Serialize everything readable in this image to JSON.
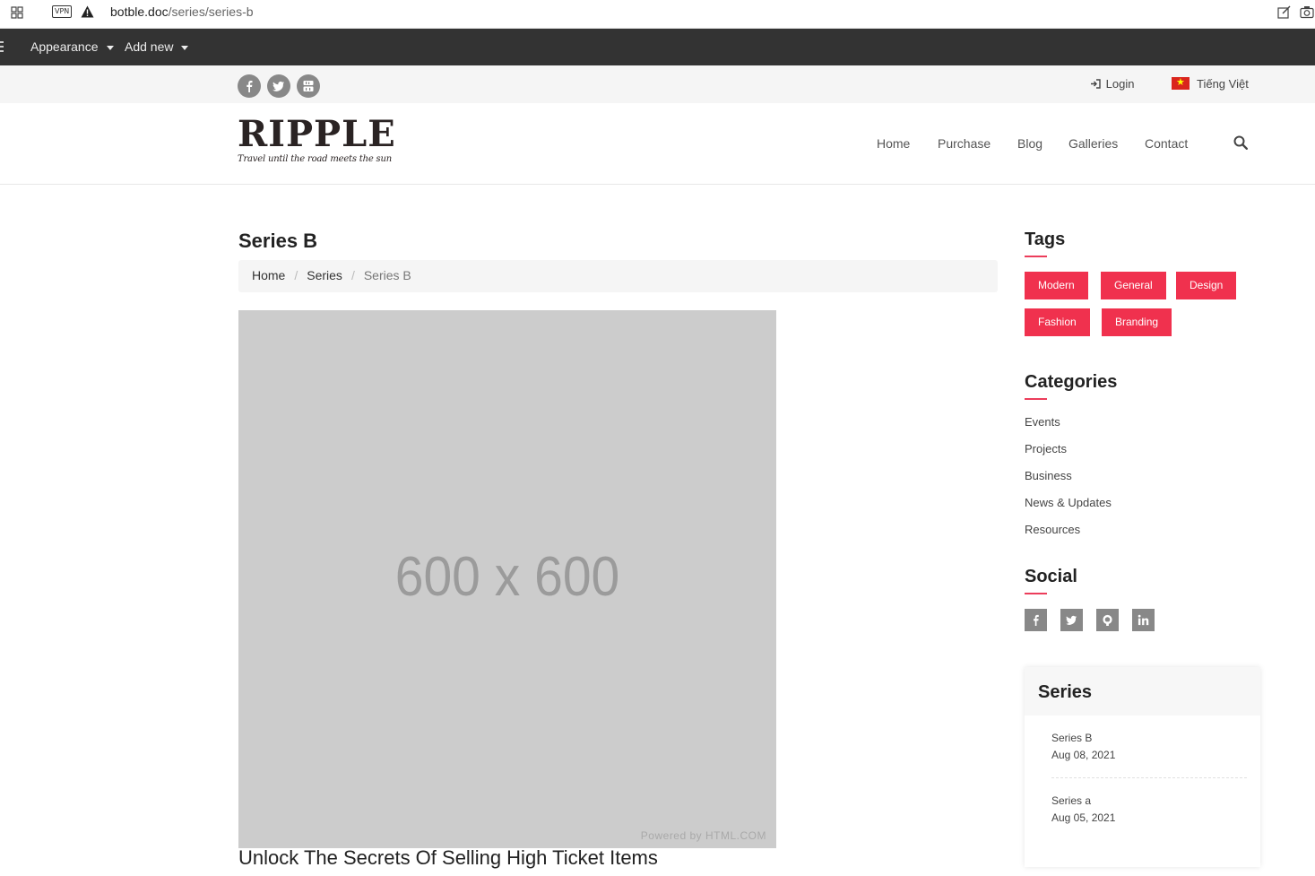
{
  "browser": {
    "url_domain": "botble.doc",
    "url_path": "/series/series-b",
    "vpn_label": "VPN",
    "icons": [
      "grid-icon",
      "warning-icon",
      "edit-icon",
      "camera-icon"
    ]
  },
  "adminbar": {
    "appearance_label": "Appearance",
    "add_new_label": "Add new"
  },
  "topbar": {
    "social_icons": [
      "facebook-icon",
      "twitter-icon",
      "youtube-icon"
    ],
    "login_label": "Login",
    "language_label": "Tiếng Việt"
  },
  "header": {
    "logo_text": "RIPPLE",
    "logo_tagline": "Travel until the road meets the sun",
    "nav": [
      "Home",
      "Purchase",
      "Blog",
      "Galleries",
      "Contact"
    ]
  },
  "main": {
    "page_title": "Series B",
    "breadcrumb": [
      "Home",
      "Series",
      "Series B"
    ],
    "image_placeholder": "600 x 600",
    "image_credit": "Powered by HTML.COM",
    "post_title": "Unlock The Secrets Of Selling High Ticket Items"
  },
  "sidebar": {
    "tags_title": "Tags",
    "tags": [
      "Modern",
      "General",
      "Design",
      "Fashion",
      "Branding"
    ],
    "categories_title": "Categories",
    "categories": [
      "Events",
      "Projects",
      "Business",
      "News & Updates",
      "Resources"
    ],
    "social_title": "Social",
    "social_icons": [
      "facebook-icon",
      "twitter-icon",
      "github-icon",
      "linkedin-icon"
    ],
    "series_title": "Series",
    "series": [
      {
        "name": "Series B",
        "date": "Aug 08, 2021"
      },
      {
        "name": "Series a",
        "date": "Aug 05, 2021"
      }
    ]
  },
  "colors": {
    "accent": "#f0314e",
    "adminbar": "#333333",
    "placeholder_bg": "#cccccc"
  }
}
